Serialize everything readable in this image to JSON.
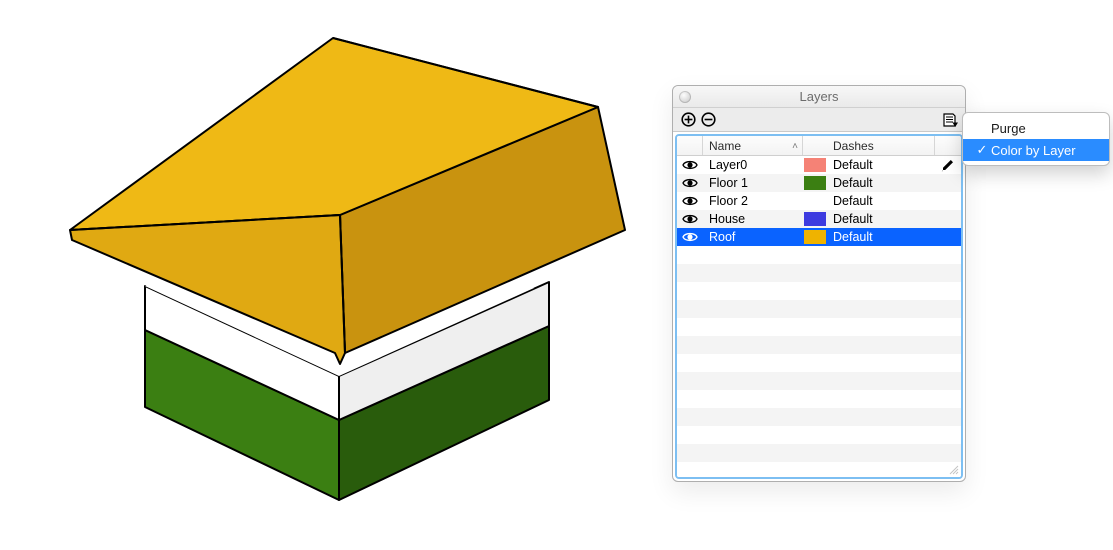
{
  "panel": {
    "title": "Layers",
    "header": {
      "name": "Name",
      "dashes": "Dashes"
    }
  },
  "layers": [
    {
      "visible": true,
      "name": "Layer0",
      "swatch": "#f58276",
      "dashes": "Default",
      "edit": true,
      "selected": false
    },
    {
      "visible": true,
      "name": "Floor 1",
      "swatch": "#3b7f12",
      "dashes": "Default",
      "edit": false,
      "selected": false
    },
    {
      "visible": true,
      "name": "Floor 2",
      "swatch": "#ffffff",
      "dashes": "Default",
      "edit": false,
      "selected": false
    },
    {
      "visible": true,
      "name": "House",
      "swatch": "#3d3be0",
      "dashes": "Default",
      "edit": false,
      "selected": false
    },
    {
      "visible": true,
      "name": "Roof",
      "swatch": "#efb300",
      "dashes": "Default",
      "edit": false,
      "selected": true
    }
  ],
  "menu": {
    "items": [
      {
        "label": "Purge",
        "checked": false,
        "highlight": false
      },
      {
        "label": "Color by Layer",
        "checked": true,
        "highlight": true
      }
    ]
  },
  "colors": {
    "roof": "#e8ac15",
    "wall": "#ffffff",
    "base": "#3b7f12",
    "edge": "#000000"
  }
}
